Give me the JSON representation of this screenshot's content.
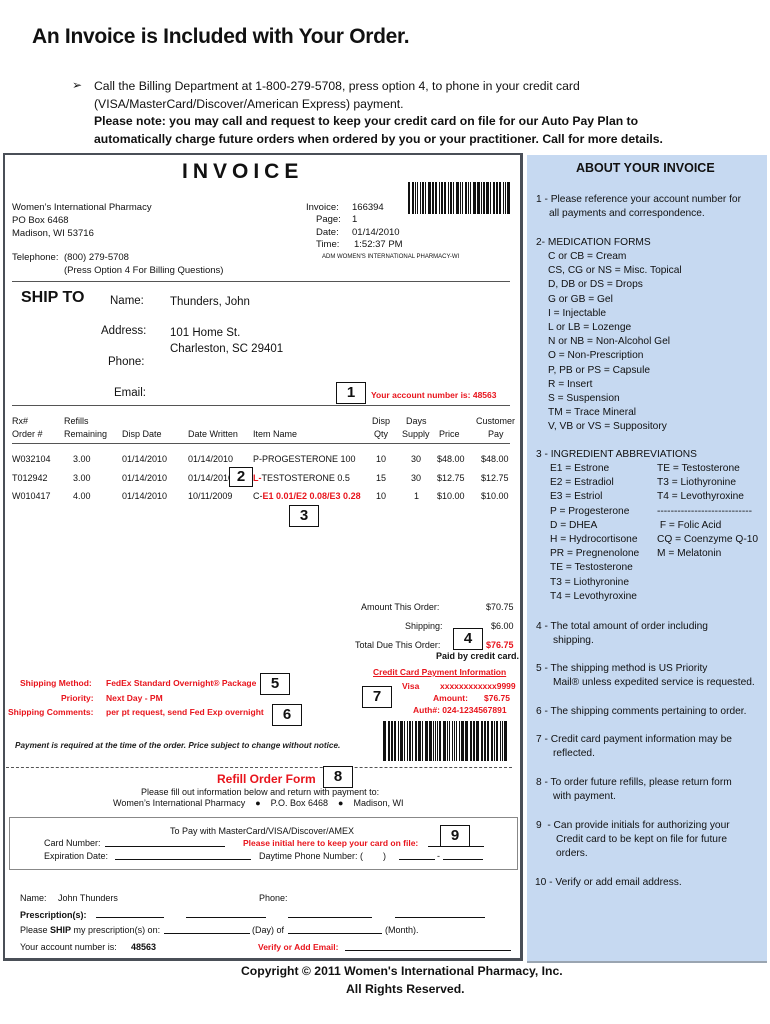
{
  "header": {
    "title": "An Invoice is Included with Your Order.",
    "bullet_icon": "arrow-bullet-icon",
    "line1": "Call the Billing Department at 1-800-279-5708, press option 4, to phone in your credit card",
    "line2": "(VISA/MasterCard/Discover/American Express) payment.",
    "line3": "Please note:  you may call and request to keep your credit card on file for our Auto Pay Plan to",
    "line4": "automatically charge future orders when ordered by you or your practitioner.  Call for more details."
  },
  "invoice": {
    "heading": "INVOICE",
    "pharmacy": {
      "name": "Women’s International Pharmacy",
      "po_box": "PO Box 6468",
      "city": "Madison, WI  53716",
      "telephone_label": "Telephone:",
      "telephone": "(800) 279-5708",
      "billing_note": "(Press Option 4 For Billing Questions)"
    },
    "meta": {
      "invoice_label": "Invoice:",
      "invoice": "166394",
      "page_label": "Page:",
      "page": "1",
      "date_label": "Date:",
      "date": "01/14/2010",
      "time_label": "Time:",
      "time": "1:52:37 PM",
      "adm": "ADM   WOMEN'S INTERNATIONAL PHARMACY-WI"
    },
    "ship_to": {
      "heading": "SHIP TO",
      "name_label": "Name:",
      "name": "Thunders, John",
      "address_label": "Address:",
      "address1": "101 Home St.",
      "address2": "Charleston, SC  29401",
      "phone_label": "Phone:",
      "phone": "",
      "email_label": "Email:",
      "email": "",
      "account_note": "Your account number is:  48563"
    },
    "table": {
      "headers": {
        "rx_top": "Rx#",
        "rx_bottom": "Order #",
        "refills_top": "Refills",
        "refills_bottom": "Remaining",
        "disp_date": "Disp Date",
        "date_written": "Date Written",
        "item_name": "Item Name",
        "disp_qty_top": "Disp",
        "disp_qty_bottom": "Qty",
        "days_top": "Days",
        "days_bottom": "Supply",
        "price": "Price",
        "cust_top": "Customer",
        "cust_bottom": "Pay"
      },
      "rows": [
        {
          "rx": "W032104",
          "refills": "3.00",
          "disp_date": "01/14/2010",
          "date_written": "01/14/2010",
          "item_prefix": "P-",
          "item_prefix_red": false,
          "item_name": "PROGESTERONE 100",
          "item_red": false,
          "qty": "10",
          "days": "30",
          "price": "$48.00",
          "pay": "$48.00"
        },
        {
          "rx": "T012942",
          "refills": "3.00",
          "disp_date": "01/14/2010",
          "date_written": "01/14/2010",
          "item_prefix": "L-",
          "item_prefix_red": true,
          "item_name": "TESTOSTERONE 0.5",
          "item_red": false,
          "qty": "15",
          "days": "30",
          "price": "$12.75",
          "pay": "$12.75"
        },
        {
          "rx": "W010417",
          "refills": "4.00",
          "disp_date": "01/14/2010",
          "date_written": "10/11/2009",
          "item_prefix": "C-",
          "item_prefix_red": false,
          "item_name": "E1 0.01/E2 0.08/E3 0.28",
          "item_red": true,
          "qty": "10",
          "days": "1",
          "price": "$10.00",
          "pay": "$10.00"
        }
      ]
    },
    "totals": {
      "amount_label": "Amount This Order:",
      "amount": "$70.75",
      "shipping_label": "Shipping:",
      "shipping": "$6.00",
      "total_label": "Total Due This Order:",
      "total": "$76.75",
      "paid_note": "Paid by credit card."
    },
    "shipping_info": {
      "method_label": "Shipping Method:",
      "method": "FedEx Standard Overnight® Package",
      "priority_label": "Priority:",
      "priority": "Next Day - PM",
      "comments_label": "Shipping Comments:",
      "comments": "per pt request, send Fed Exp overnight"
    },
    "credit_card": {
      "heading": "Credit Card Payment Information",
      "type": "Visa",
      "number": "xxxxxxxxxxxx9999",
      "amount_label": "Amount:",
      "amount": "$76.75",
      "auth": "Auth#: 024-1234567891"
    },
    "payment_note": "Payment is required at the time of the order.  Price subject to change without notice.",
    "callouts": [
      "1",
      "2",
      "3",
      "4",
      "5",
      "6",
      "7",
      "8",
      "9"
    ]
  },
  "refill_form": {
    "title": "Refill Order Form",
    "instruction": "Please fill out information below and return with payment to:",
    "address": "Women’s International Pharmacy    ●    P.O. Box 6468    ●    Madison, WI",
    "pay_heading": "To Pay with MasterCard/VISA/Discover/AMEX",
    "card_number_label": "Card Number:",
    "card_number_value": "",
    "initial_label": "Please initial here to keep your card on file:",
    "initial_value": "",
    "expiration_label": "Expiration Date:",
    "expiration_value": "",
    "phone_label": "Daytime Phone Number: (        )",
    "phone_value": "",
    "name_label": "Name:",
    "name": "John Thunders",
    "phone2_label": "Phone:",
    "prescriptions_label": "Prescription(s):",
    "ship_prefix": "Please ",
    "ship_bold": "SHIP",
    "ship_suffix": " my prescription(s) on:",
    "day_label": "(Day) of",
    "month_label": "(Month).",
    "account_label": "Your account number is:",
    "account": "48563",
    "verify_email_label": "Verify or Add Email:"
  },
  "about": {
    "title": "ABOUT YOUR INVOICE",
    "item1_a": "1 - Please reference your account number for",
    "item1_b": "all payments and correspondence.",
    "item2_title": "2- MEDICATION FORMS",
    "medication_forms": [
      "C or CB = Cream",
      "CS, CG or NS = Misc. Topical",
      "D, DB or DS = Drops",
      "G or GB = Gel",
      "I = Injectable",
      "L or LB = Lozenge",
      "N or NB = Non-Alcohol Gel",
      "O = Non-Prescription",
      "P, PB or PS = Capsule",
      "R = Insert",
      "S = Suspension",
      "TM = Trace Mineral",
      "V, VB or VS = Suppository"
    ],
    "item3_title": "3 - INGREDIENT ABBREVIATIONS",
    "ingredients_left": [
      "E1 = Estrone",
      "E2 = Estradiol",
      "E3 = Estriol",
      "P = Progesterone",
      "D = DHEA",
      "H = Hydrocortisone",
      "PR = Pregnenolone",
      "TE = Testosterone",
      "T3 = Liothyronine",
      "T4 = Levothyroxine"
    ],
    "ingredients_right": [
      "TE = Testosterone",
      "T3 = Liothyronine",
      "T4 = Levothyroxine",
      "----------------------------",
      " F = Folic Acid",
      "CQ = Coenzyme Q-10",
      "M = Melatonin"
    ],
    "item4_a": "4 - The total amount of order including",
    "item4_b": "shipping.",
    "item5_a": "5 - The shipping method is US Priority",
    "item5_b": "Mail® unless expedited service is requested.",
    "item6": "6 - The shipping comments pertaining to order.",
    "item7_a": "7 - Credit card payment information may be",
    "item7_b": "reflected.",
    "item8_a": "8 - To order future refills, please return form",
    "item8_b": "with payment.",
    "item9_a": "9  - Can provide initials for authorizing your",
    "item9_b": "Credit card to be kept on file for future",
    "item9_c": "orders.",
    "item10": "10 - Verify or add email address."
  },
  "footer": {
    "copyright": "Copyright © 2011 Women's International Pharmacy, Inc.",
    "rights": "All Rights Reserved."
  },
  "colors": {
    "accent_red": "#e8141c",
    "panel_blue": "#c6d9f1"
  }
}
